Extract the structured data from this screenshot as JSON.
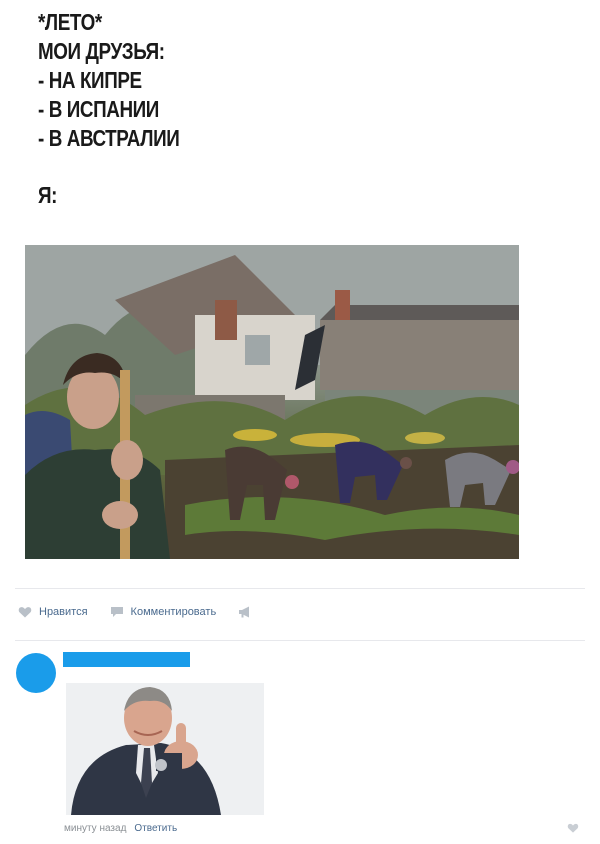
{
  "post": {
    "text_lines": [
      "*ЛЕТО*",
      "МОИ ДРУЗЬЯ:",
      "- НА КИПРЕ",
      "- В ИСПАНИИ",
      "- В АВСТРАЛИИ"
    ],
    "me_line": "Я:"
  },
  "actions": {
    "like_label": "Нравится",
    "comment_label": "Комментировать"
  },
  "comment": {
    "time": "минуту назад",
    "reply_label": "Ответить"
  },
  "colors": {
    "accent": "#1a9cea",
    "link": "#4a6a8e",
    "icon_gray": "#b9c0c8"
  }
}
